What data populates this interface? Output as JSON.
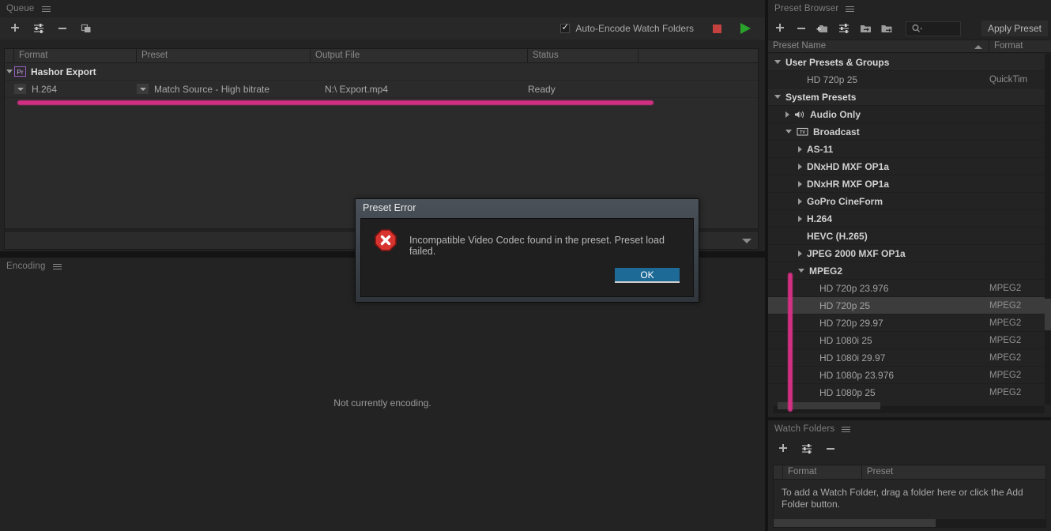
{
  "queue": {
    "panel_title": "Queue",
    "toolbar": [
      {
        "name": "add-source-button",
        "icon": "plus-icon"
      },
      {
        "name": "add-output-button",
        "icon": "sliders-icon"
      },
      {
        "name": "remove-button",
        "icon": "minus-icon"
      },
      {
        "name": "duplicate-button",
        "icon": "duplicate-icon"
      }
    ],
    "auto_encode_label": "Auto-Encode Watch Folders",
    "auto_encode_checked": true,
    "stop_button": "stop-queue-button",
    "start_button": "start-queue-button",
    "columns": [
      "Format",
      "Preset",
      "Output File",
      "Status"
    ],
    "group_row": {
      "label": "Hashor Export",
      "badge": "Pr"
    },
    "item_row": {
      "format": "H.264",
      "preset": "Match Source - High bitrate",
      "output_file": "N:\\  Export.mp4",
      "status": "Ready"
    }
  },
  "encoding": {
    "panel_title": "Encoding",
    "empty_message": "Not currently encoding."
  },
  "preset_browser": {
    "panel_title": "Preset Browser",
    "toolbar": [
      {
        "name": "new-preset-button",
        "icon": "plus-icon"
      },
      {
        "name": "delete-preset-button",
        "icon": "minus-icon"
      },
      {
        "name": "new-folder-button",
        "icon": "new-folder-icon"
      },
      {
        "name": "preset-settings-button",
        "icon": "sliders-icon"
      },
      {
        "name": "import-preset-button",
        "icon": "import-folder-icon"
      },
      {
        "name": "export-preset-button",
        "icon": "export-folder-icon"
      }
    ],
    "search_placeholder": "",
    "apply_preset_label": "Apply Preset",
    "columns": {
      "name": "Preset Name",
      "format": "Format"
    },
    "sort": "ascending",
    "rows": [
      {
        "label": "User Presets & Groups",
        "format": "",
        "level": 0,
        "kind": "group",
        "twist": "down"
      },
      {
        "label": "HD 720p 25",
        "format": "QuickTim",
        "level": 2,
        "kind": "leaf",
        "twist": "none"
      },
      {
        "label": "System Presets",
        "format": "",
        "level": 0,
        "kind": "group",
        "twist": "down"
      },
      {
        "label": "Audio Only",
        "format": "",
        "level": 1,
        "kind": "folder",
        "twist": "right",
        "icon": "speaker-icon"
      },
      {
        "label": "Broadcast",
        "format": "",
        "level": 1,
        "kind": "folder",
        "twist": "down",
        "icon": "tv-icon"
      },
      {
        "label": "AS-11",
        "format": "",
        "level": 2,
        "kind": "folder",
        "twist": "right"
      },
      {
        "label": "DNxHD MXF OP1a",
        "format": "",
        "level": 2,
        "kind": "folder",
        "twist": "right"
      },
      {
        "label": "DNxHR MXF OP1a",
        "format": "",
        "level": 2,
        "kind": "folder",
        "twist": "right"
      },
      {
        "label": "GoPro CineForm",
        "format": "",
        "level": 2,
        "kind": "folder",
        "twist": "right"
      },
      {
        "label": "H.264",
        "format": "",
        "level": 2,
        "kind": "folder",
        "twist": "right"
      },
      {
        "label": "HEVC (H.265)",
        "format": "",
        "level": 2,
        "kind": "folder",
        "twist": "none"
      },
      {
        "label": "JPEG 2000 MXF OP1a",
        "format": "",
        "level": 2,
        "kind": "folder",
        "twist": "right"
      },
      {
        "label": "MPEG2",
        "format": "",
        "level": 2,
        "kind": "folder",
        "twist": "down"
      },
      {
        "label": "HD 720p 23.976",
        "format": "MPEG2",
        "level": 3,
        "kind": "leaf",
        "twist": "none"
      },
      {
        "label": "HD 720p 25",
        "format": "MPEG2",
        "level": 3,
        "kind": "leaf",
        "twist": "none",
        "selected": true
      },
      {
        "label": "HD 720p 29.97",
        "format": "MPEG2",
        "level": 3,
        "kind": "leaf",
        "twist": "none"
      },
      {
        "label": "HD 1080i 25",
        "format": "MPEG2",
        "level": 3,
        "kind": "leaf",
        "twist": "none"
      },
      {
        "label": "HD 1080i 29.97",
        "format": "MPEG2",
        "level": 3,
        "kind": "leaf",
        "twist": "none"
      },
      {
        "label": "HD 1080p 23.976",
        "format": "MPEG2",
        "level": 3,
        "kind": "leaf",
        "twist": "none"
      },
      {
        "label": "HD 1080p 25",
        "format": "MPEG2",
        "level": 3,
        "kind": "leaf",
        "twist": "none"
      }
    ]
  },
  "watch_folders": {
    "panel_title": "Watch Folders",
    "toolbar": [
      {
        "name": "add-watch-folder-button",
        "icon": "plus-icon"
      },
      {
        "name": "watch-folder-settings-button",
        "icon": "sliders-icon"
      },
      {
        "name": "remove-watch-folder-button",
        "icon": "minus-icon"
      }
    ],
    "columns": [
      "Format",
      "Preset"
    ],
    "empty_message": "To add a Watch Folder, drag a folder here or click the Add Folder button."
  },
  "dialog": {
    "title": "Preset Error",
    "message": "Incompatible Video Codec found in the preset. Preset load failed.",
    "ok_label": "OK",
    "icon": "error-octagon-icon"
  },
  "annotations": {
    "color": "#e0308a",
    "marks": [
      "queue-row-underline",
      "preset-list-vertical-bar"
    ]
  }
}
